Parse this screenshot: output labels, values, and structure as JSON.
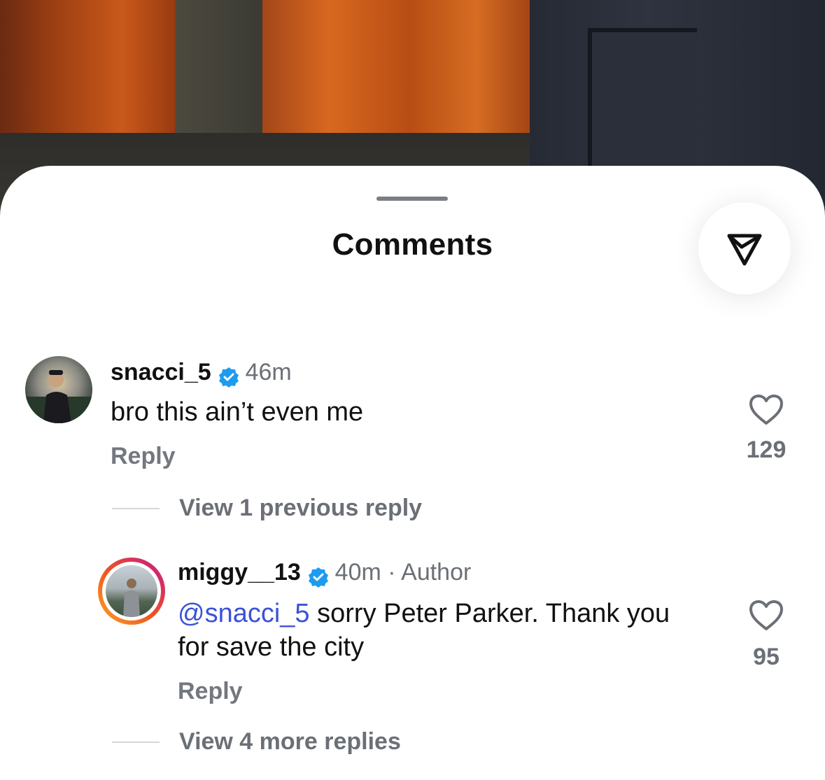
{
  "sheet": {
    "title": "Comments"
  },
  "icons": {
    "share": "paper-plane-icon",
    "like": "heart-outline-icon",
    "verified": "verified-badge-icon"
  },
  "colors": {
    "verified": "#1d9bf0",
    "mention": "#3b52d6",
    "story_ring_start": "#f9a825",
    "story_ring_end": "#c2178f"
  },
  "comments": [
    {
      "username": "snacci_5",
      "verified": true,
      "time": "46m",
      "text": "bro this ain’t even me",
      "reply_label": "Reply",
      "likes": "129",
      "view_replies": "View 1 previous reply"
    },
    {
      "username": "miggy__13",
      "verified": true,
      "time_meta": "40m · Author",
      "mention": "@snacci_5",
      "text": " sorry Peter Parker. Thank you for save the city",
      "reply_label": "Reply",
      "likes": "95",
      "view_replies": "View 4 more replies"
    }
  ]
}
